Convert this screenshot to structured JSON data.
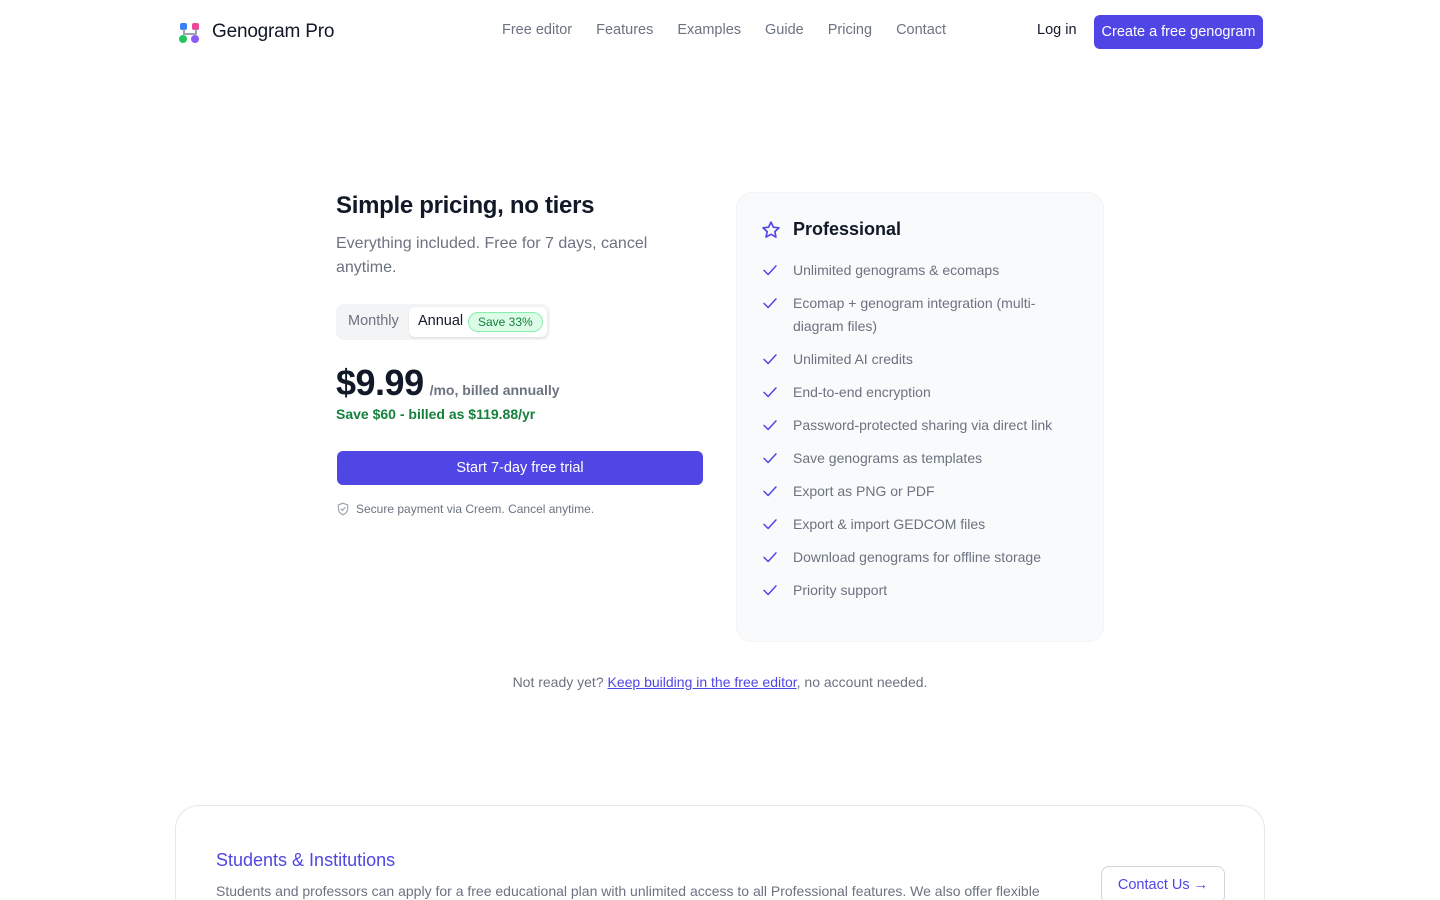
{
  "header": {
    "logo_icon": "genogram-logo-icon",
    "brand": "Genogram Pro",
    "nav": [
      {
        "label": "Free editor"
      },
      {
        "label": "Features"
      },
      {
        "label": "Examples"
      },
      {
        "label": "Guide"
      },
      {
        "label": "Pricing"
      },
      {
        "label": "Contact"
      }
    ],
    "login_label": "Log in",
    "cta_label": "Create a free genogram"
  },
  "pricing": {
    "title": "Simple pricing, no tiers",
    "subtitle": "Everything included. Free for 7 days, cancel anytime.",
    "toggle": {
      "monthly_label": "Monthly",
      "annual_label": "Annual",
      "save_badge": "Save 33%",
      "selected": "Annual"
    },
    "price": "$9.99",
    "price_unit": "/mo, billed annually",
    "savings": "Save $60 - billed as $119.88/yr",
    "trial_button": "Start 7-day free trial",
    "secure_icon": "shield-check-icon",
    "secure_note": "Secure payment via Creem. Cancel anytime."
  },
  "plan": {
    "icon": "star-icon",
    "name": "Professional",
    "check_icon": "check-icon",
    "features": [
      "Unlimited genograms & ecomaps",
      "Ecomap + genogram integration (multi-diagram files)",
      "Unlimited AI credits",
      "End-to-end encryption",
      "Password-protected sharing via direct link",
      "Save genograms as templates",
      "Export as PNG or PDF",
      "Export & import GEDCOM files",
      "Download genograms for offline storage",
      "Priority support"
    ]
  },
  "not_ready": {
    "prefix": "Not ready yet?",
    "link": "Keep building in the free editor",
    "suffix": ", no account needed."
  },
  "students": {
    "title": "Students & Institutions",
    "text": "Students and professors can apply for a free educational plan with unlimited access to all Professional features. We also offer flexible",
    "button": "Contact Us →"
  },
  "colors": {
    "accent": "#4f46e5",
    "success": "#15803d",
    "muted_text": "#6b7280"
  }
}
